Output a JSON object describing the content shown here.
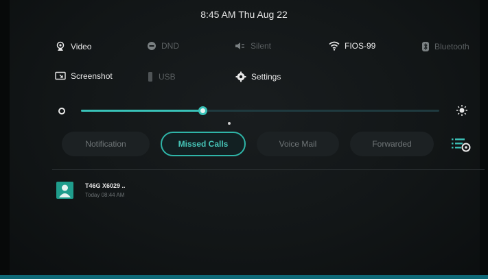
{
  "status_bar": {
    "datetime": "8:45 AM Thu Aug 22"
  },
  "quick_settings": {
    "row1": [
      {
        "label": "Video",
        "icon": "video-camera-icon",
        "state": "on"
      },
      {
        "label": "DND",
        "icon": "dnd-icon",
        "state": "off"
      },
      {
        "label": "Silent",
        "icon": "speaker-icon",
        "state": "off"
      },
      {
        "label": "FIOS-99",
        "icon": "wifi-icon",
        "state": "on"
      },
      {
        "label": "Bluetooth",
        "icon": "bluetooth-icon",
        "state": "off"
      }
    ],
    "row2": [
      {
        "label": "Screenshot",
        "icon": "screenshot-icon",
        "state": "on"
      },
      {
        "label": "USB",
        "icon": "usb-icon",
        "state": "off"
      },
      {
        "label": "Settings",
        "icon": "gear-icon",
        "state": "on"
      }
    ]
  },
  "brightness": {
    "level": 0.34
  },
  "tabs": [
    {
      "label": "Notification",
      "active": false
    },
    {
      "label": "Missed Calls",
      "active": true
    },
    {
      "label": "Voice Mail",
      "active": false
    },
    {
      "label": "Forwarded",
      "active": false
    }
  ],
  "missed_calls": [
    {
      "name": "T46G X6029 ..",
      "time": "Today 08:44 AM"
    }
  ],
  "colors": {
    "accent": "#39c2b8",
    "active_tab_text": "#47c6b9",
    "avatar": "#1f9d8c",
    "bottom_bar": "#0f6a78"
  }
}
